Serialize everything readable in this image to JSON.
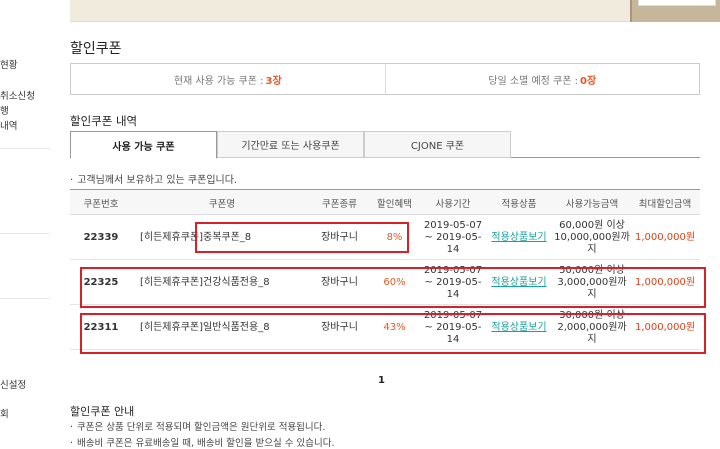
{
  "sidebar": {
    "items": [
      "현황",
      "취소신청",
      "행",
      "내역",
      "신설정",
      "회"
    ]
  },
  "page_title": "할인쿠폰",
  "summary": {
    "available_label": "현재 사용 가능 쿠폰 :",
    "available_count": "3장",
    "expiring_label": "당일 소멸 예정 쿠폰 :",
    "expiring_count": "0장"
  },
  "section_title": "할인쿠폰 내역",
  "tabs": [
    "사용 가능 쿠폰",
    "기간만료 또는 사용쿠폰",
    "CJONE 쿠폰"
  ],
  "notice": "고객님께서 보유하고 있는 쿠폰입니다.",
  "table": {
    "headers": [
      "쿠폰번호",
      "쿠폰명",
      "쿠폰종류",
      "할인혜택",
      "사용기간",
      "적용상품",
      "사용가능금액",
      "최대할인금액"
    ],
    "rows": [
      {
        "number": "22339",
        "name": "[히든제휴쿠폰]중복쿠폰_8",
        "type": "장바구니",
        "benefit": "8%",
        "period_start": "2019-05-07",
        "period_end": "~ 2019-05-",
        "period_end2": "14",
        "products": "적용상품보기",
        "min_amount": "60,000원 이상",
        "max_amount": "10,000,000원까",
        "max_amount2": "지",
        "max_discount": "1,000,000원"
      },
      {
        "number": "22325",
        "name": "[히든제휴쿠폰]건강식품전용_8",
        "type": "장바구니",
        "benefit": "60%",
        "period_start": "2019-05-07",
        "period_end": "~ 2019-05-",
        "period_end2": "14",
        "products": "적용상품보기",
        "min_amount": "50,000원 이상",
        "max_amount": "3,000,000원까지",
        "max_amount2": "",
        "max_discount": "1,000,000원"
      },
      {
        "number": "22311",
        "name": "[히든제휴쿠폰]일반식품전용_8",
        "type": "장바구니",
        "benefit": "43%",
        "period_start": "2019-05-07",
        "period_end": "~ 2019-05-",
        "period_end2": "14",
        "products": "적용상품보기",
        "min_amount": "30,000원 이상",
        "max_amount": "2,000,000원까지",
        "max_amount2": "",
        "max_discount": "1,000,000원"
      }
    ]
  },
  "pagination": {
    "current": "1"
  },
  "guide": {
    "title": "할인쿠폰 안내",
    "items": [
      "쿠폰은 상품 단위로 적용되며 할인금액은 원단위로 적용됩니다.",
      "배송비 쿠폰은 유료배송일 때, 배송비 할인을 받으실 수 있습니다."
    ]
  },
  "colors": {
    "accent": "#e05a2a",
    "link": "#1aa0a0",
    "highlight_box": "#d8202c"
  }
}
